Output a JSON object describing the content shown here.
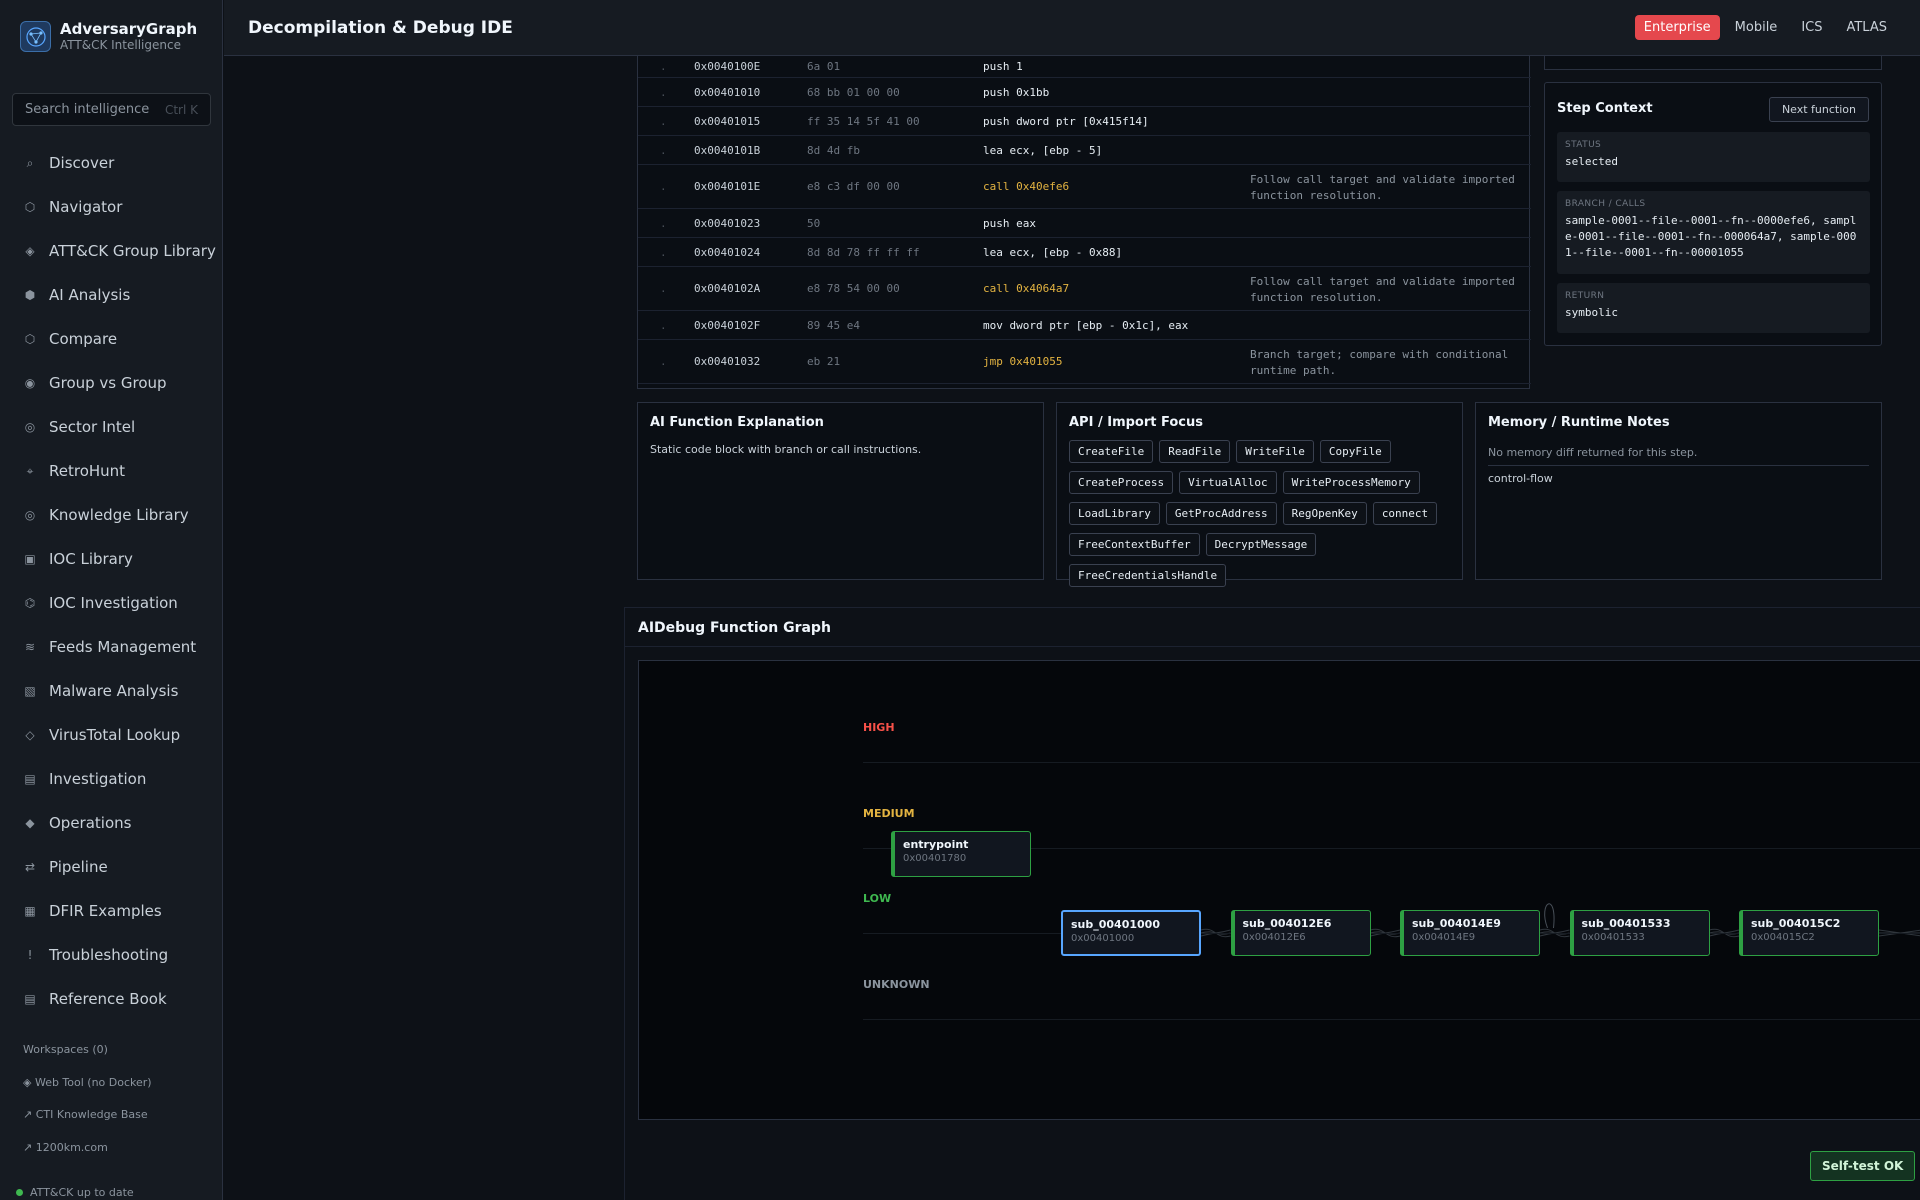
{
  "brand": {
    "title": "AdversaryGraph",
    "subtitle": "ATT&CK Intelligence"
  },
  "search": {
    "placeholder": "Search intelligence",
    "shortcut": "Ctrl K"
  },
  "sidebar": {
    "items": [
      {
        "icon": "⌕",
        "icon_name": "search-icon",
        "label": "Discover"
      },
      {
        "icon": "⬡",
        "icon_name": "hexagon-icon",
        "label": "Navigator"
      },
      {
        "icon": "◈",
        "icon_name": "diamond-icon",
        "label": "ATT&CK Group Library"
      },
      {
        "icon": "⬢",
        "icon_name": "filled-hexagon-icon",
        "label": "AI Analysis"
      },
      {
        "icon": "⬡",
        "icon_name": "hexagon-icon",
        "label": "Compare"
      },
      {
        "icon": "◉",
        "icon_name": "target-icon",
        "label": "Group vs Group"
      },
      {
        "icon": "◎",
        "icon_name": "circle-icon",
        "label": "Sector Intel"
      },
      {
        "icon": "⌖",
        "icon_name": "crosshair-icon",
        "label": "RetroHunt"
      },
      {
        "icon": "◎",
        "icon_name": "circle-icon",
        "label": "Knowledge Library"
      },
      {
        "icon": "▣",
        "icon_name": "square-icon",
        "label": "IOC Library"
      },
      {
        "icon": "⌬",
        "icon_name": "ring-icon",
        "label": "IOC Investigation"
      },
      {
        "icon": "≋",
        "icon_name": "feeds-icon",
        "label": "Feeds Management"
      },
      {
        "icon": "▧",
        "icon_name": "hatched-square-icon",
        "label": "Malware Analysis"
      },
      {
        "icon": "◇",
        "icon_name": "outline-diamond-icon",
        "label": "VirusTotal Lookup"
      },
      {
        "icon": "▤",
        "icon_name": "list-square-icon",
        "label": "Investigation"
      },
      {
        "icon": "◆",
        "icon_name": "filled-diamond-icon",
        "label": "Operations"
      },
      {
        "icon": "⇄",
        "icon_name": "arrows-icon",
        "label": "Pipeline"
      },
      {
        "icon": "▦",
        "icon_name": "grid-icon",
        "label": "DFIR Examples"
      },
      {
        "icon": "!",
        "icon_name": "alert-icon",
        "label": "Troubleshooting"
      },
      {
        "icon": "▤",
        "icon_name": "book-icon",
        "label": "Reference Book"
      }
    ],
    "workspaces": "Workspaces (0)",
    "links": [
      "◈ Web Tool (no Docker)",
      "↗ CTI Knowledge Base",
      "↗ 1200km.com"
    ],
    "status": "ATT&CK up to date"
  },
  "header": {
    "title": "Decompilation & Debug IDE",
    "tabs": [
      "Enterprise",
      "Mobile",
      "ICS",
      "ATLAS"
    ],
    "active_tab": "Enterprise"
  },
  "disassembly": {
    "rows": [
      {
        "mark": ".",
        "addr": "0x0040100E",
        "bytes": "6a 01",
        "instr": "push 1",
        "kind": "",
        "note": ""
      },
      {
        "mark": ".",
        "addr": "0x00401010",
        "bytes": "68 bb 01 00 00",
        "instr": "push 0x1bb",
        "kind": "",
        "note": ""
      },
      {
        "mark": ".",
        "addr": "0x00401015",
        "bytes": "ff 35 14 5f 41 00",
        "instr": "push dword ptr [0x415f14]",
        "kind": "",
        "note": ""
      },
      {
        "mark": ".",
        "addr": "0x0040101B",
        "bytes": "8d 4d fb",
        "instr": "lea ecx, [ebp - 5]",
        "kind": "",
        "note": ""
      },
      {
        "mark": ".",
        "addr": "0x0040101E",
        "bytes": "e8 c3 df 00 00",
        "instr": "call 0x40efe6",
        "kind": "call",
        "note": "Follow call target and validate imported function resolution."
      },
      {
        "mark": ".",
        "addr": "0x00401023",
        "bytes": "50",
        "instr": "push eax",
        "kind": "",
        "note": ""
      },
      {
        "mark": ".",
        "addr": "0x00401024",
        "bytes": "8d 8d 78 ff ff ff",
        "instr": "lea ecx, [ebp - 0x88]",
        "kind": "",
        "note": ""
      },
      {
        "mark": ".",
        "addr": "0x0040102A",
        "bytes": "e8 78 54 00 00",
        "instr": "call 0x4064a7",
        "kind": "call",
        "note": "Follow call target and validate imported function resolution."
      },
      {
        "mark": ".",
        "addr": "0x0040102F",
        "bytes": "89 45 e4",
        "instr": "mov dword ptr [ebp - 0x1c], eax",
        "kind": "",
        "note": ""
      },
      {
        "mark": ".",
        "addr": "0x00401032",
        "bytes": "eb 21",
        "instr": "jmp 0x401055",
        "kind": "jmp",
        "note": "Branch target; compare with conditional runtime path."
      }
    ]
  },
  "step_context": {
    "title": "Step Context",
    "next_label": "Next function",
    "status_label": "STATUS",
    "status": "selected",
    "branch_label": "BRANCH / CALLS",
    "branch": "sample-0001--file--0001--fn--0000efe6, sample-0001--file--0001--fn--000064a7, sample-0001--file--0001--fn--00001055",
    "return_label": "RETURN",
    "return": "symbolic"
  },
  "ai_panel": {
    "title": "AI Function Explanation",
    "text": "Static code block with branch or call instructions."
  },
  "api_panel": {
    "title": "API / Import Focus",
    "chips": [
      "CreateFile",
      "ReadFile",
      "WriteFile",
      "CopyFile",
      "CreateProcess",
      "VirtualAlloc",
      "WriteProcessMemory",
      "LoadLibrary",
      "GetProcAddress",
      "RegOpenKey",
      "connect",
      "FreeContextBuffer",
      "DecryptMessage",
      "FreeCredentialsHandle"
    ]
  },
  "memory_panel": {
    "title": "Memory / Runtime Notes",
    "note": "No memory diff returned for this step.",
    "tag": "control-flow"
  },
  "graph": {
    "title": "AIDebug Function Graph",
    "bands": [
      {
        "label": "HIGH",
        "color": "#f85149"
      },
      {
        "label": "MEDIUM",
        "color": "#e3b341"
      },
      {
        "label": "LOW",
        "color": "#3fb950"
      },
      {
        "label": "UNKNOWN",
        "color": "#8b949e"
      }
    ],
    "nodes": [
      {
        "name": "entrypoint",
        "addr": "0x00401780",
        "band": "MEDIUM",
        "selected": false
      },
      {
        "name": "sub_00401000",
        "addr": "0x00401000",
        "band": "LOW",
        "selected": true
      },
      {
        "name": "sub_004012E6",
        "addr": "0x004012E6",
        "band": "LOW",
        "selected": false
      },
      {
        "name": "sub_004014E9",
        "addr": "0x004014E9",
        "band": "LOW",
        "selected": false
      },
      {
        "name": "sub_00401533",
        "addr": "0x00401533",
        "band": "LOW",
        "selected": false
      },
      {
        "name": "sub_004015C2",
        "addr": "0x004015C2",
        "band": "LOW",
        "selected": false
      }
    ]
  },
  "self_test": "Self-test OK",
  "colors": {
    "accent": "#e5484d",
    "low": "#2ea043",
    "selected": "#58a6ff",
    "call": "#e3b341"
  }
}
